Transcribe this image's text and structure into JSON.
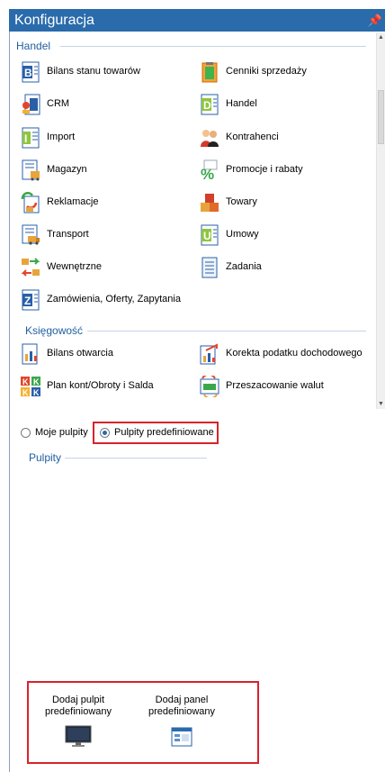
{
  "window": {
    "title": "Konfiguracja",
    "pin_glyph": "I"
  },
  "sections": {
    "handel": {
      "title": "Handel",
      "items": [
        {
          "label": "Bilans stanu towarów",
          "icon": "document-b-icon"
        },
        {
          "label": "Cenniki sprzedaży",
          "icon": "price-list-icon"
        },
        {
          "label": "CRM",
          "icon": "crm-icon"
        },
        {
          "label": "Handel",
          "icon": "document-d-icon"
        },
        {
          "label": "Import",
          "icon": "document-i-icon"
        },
        {
          "label": "Kontrahenci",
          "icon": "contractors-icon"
        },
        {
          "label": "Magazyn",
          "icon": "warehouse-icon"
        },
        {
          "label": "Promocje i rabaty",
          "icon": "percent-icon"
        },
        {
          "label": "Reklamacje",
          "icon": "complaints-icon"
        },
        {
          "label": "Towary",
          "icon": "goods-boxes-icon"
        },
        {
          "label": "Transport",
          "icon": "truck-icon"
        },
        {
          "label": "Umowy",
          "icon": "document-u-icon"
        },
        {
          "label": "Wewnętrzne",
          "icon": "internal-arrows-icon"
        },
        {
          "label": "Zadania",
          "icon": "tasks-icon"
        },
        {
          "label": "Zamówienia, Oferty, Zapytania",
          "icon": "document-z-icon"
        }
      ]
    },
    "ksiegowosc": {
      "title": "Księgowość",
      "items": [
        {
          "label": "Bilans otwarcia",
          "icon": "opening-balance-icon"
        },
        {
          "label": "Korekta podatku dochodowego",
          "icon": "tax-correction-icon"
        },
        {
          "label": "Plan kont/Obroty i Salda",
          "icon": "chart-of-accounts-icon"
        },
        {
          "label": "Przeszacowanie walut",
          "icon": "currency-revaluation-icon"
        }
      ]
    }
  },
  "mode": {
    "option1": "Moje pulpity",
    "option2": "Pulpity predefiniowane",
    "selected": "Pulpity predefiniowane"
  },
  "pulpity": {
    "title": "Pulpity"
  },
  "actions": {
    "add_desktop": "Dodaj pulpit predefiniowany",
    "add_panel": "Dodaj panel predefiniowany"
  },
  "colors": {
    "titlebar": "#2a6bab",
    "section": "#1f5fa0",
    "highlight": "#d8232a"
  }
}
